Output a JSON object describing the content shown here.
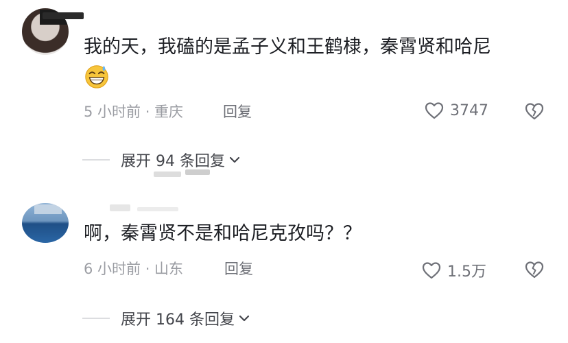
{
  "comments": [
    {
      "text": "我的天，我磕的是孟子义和王鹤棣，秦霄贤和哈尼",
      "emoji_icon": "grinning-sweat-emoji",
      "meta": "5 小时前 · 重庆",
      "reply_label": "回复",
      "like_count": "3747",
      "expand_label": "展开 94 条回复"
    },
    {
      "text": "啊，秦霄贤不是和哈尼克孜吗？？",
      "meta": "6 小时前 · 山东",
      "reply_label": "回复",
      "like_count": "1.5万",
      "expand_label": "展开 164 条回复"
    }
  ]
}
